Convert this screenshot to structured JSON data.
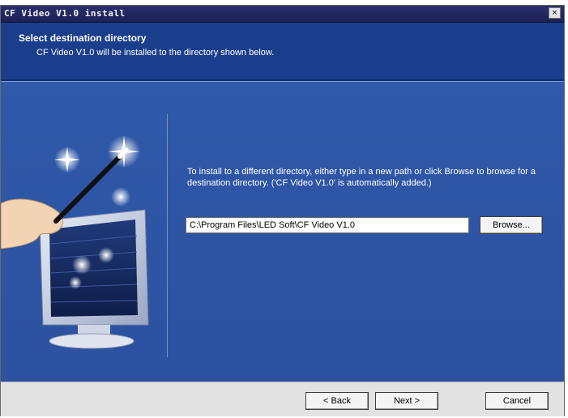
{
  "window": {
    "title": "CF Video V1.0 install",
    "close_glyph": "×"
  },
  "header": {
    "title": "Select destination directory",
    "subtitle": "CF Video V1.0 will be installed to the directory shown below."
  },
  "main": {
    "instructions": "To install to a different directory, either type in a new path or click Browse to browse for a destination directory. ('CF Video V1.0' is automatically added.)",
    "path_value": "C:\\Program Files\\LED Soft\\CF Video V1.0",
    "browse_label": "Browse..."
  },
  "footer": {
    "back_label": "< Back",
    "next_label": "Next >",
    "cancel_label": "Cancel"
  },
  "colors": {
    "titlebar": "#1c2156",
    "header": "#1b3e8c",
    "panel": "#2c51a0",
    "footer": "#e2e2e2"
  },
  "icons": [
    "close-icon",
    "wizard-illustration",
    "magic-wand-icon",
    "monitor-icon",
    "hand-icon",
    "sparkle-icon"
  ]
}
